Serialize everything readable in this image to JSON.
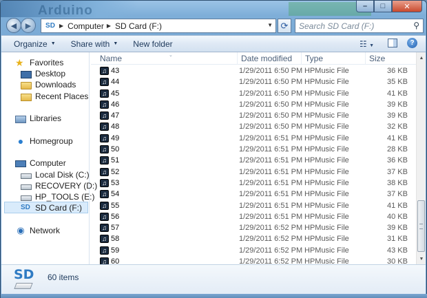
{
  "titlebar": {
    "background_text": "Arduino"
  },
  "caption_buttons": {
    "minimize": "–",
    "maximize": "□",
    "close": "✕"
  },
  "address": {
    "crumbs": [
      "Computer",
      "SD Card (F:)"
    ],
    "icon_label": "SD"
  },
  "search": {
    "placeholder": "Search SD Card (F:)"
  },
  "commands": {
    "organize": "Organize",
    "share_with": "Share with",
    "new_folder": "New folder"
  },
  "nav": {
    "favorites": "Favorites",
    "desktop": "Desktop",
    "downloads": "Downloads",
    "recent_places": "Recent Places",
    "libraries": "Libraries",
    "homegroup": "Homegroup",
    "computer": "Computer",
    "local_disk": "Local Disk (C:)",
    "recovery": "RECOVERY (D:)",
    "hp_tools": "HP_TOOLS (E:)",
    "sd_card": "SD Card (F:)",
    "network": "Network"
  },
  "columns": {
    "name": "Name",
    "date": "Date modified",
    "type": "Type",
    "size": "Size"
  },
  "files": [
    {
      "name": "43",
      "date": "1/29/2011 6:50 PM",
      "type": "HPMusic File",
      "size": "36 KB"
    },
    {
      "name": "44",
      "date": "1/29/2011 6:50 PM",
      "type": "HPMusic File",
      "size": "35 KB"
    },
    {
      "name": "45",
      "date": "1/29/2011 6:50 PM",
      "type": "HPMusic File",
      "size": "41 KB"
    },
    {
      "name": "46",
      "date": "1/29/2011 6:50 PM",
      "type": "HPMusic File",
      "size": "39 KB"
    },
    {
      "name": "47",
      "date": "1/29/2011 6:50 PM",
      "type": "HPMusic File",
      "size": "39 KB"
    },
    {
      "name": "48",
      "date": "1/29/2011 6:50 PM",
      "type": "HPMusic File",
      "size": "32 KB"
    },
    {
      "name": "49",
      "date": "1/29/2011 6:51 PM",
      "type": "HPMusic File",
      "size": "41 KB"
    },
    {
      "name": "50",
      "date": "1/29/2011 6:51 PM",
      "type": "HPMusic File",
      "size": "28 KB"
    },
    {
      "name": "51",
      "date": "1/29/2011 6:51 PM",
      "type": "HPMusic File",
      "size": "36 KB"
    },
    {
      "name": "52",
      "date": "1/29/2011 6:51 PM",
      "type": "HPMusic File",
      "size": "37 KB"
    },
    {
      "name": "53",
      "date": "1/29/2011 6:51 PM",
      "type": "HPMusic File",
      "size": "38 KB"
    },
    {
      "name": "54",
      "date": "1/29/2011 6:51 PM",
      "type": "HPMusic File",
      "size": "37 KB"
    },
    {
      "name": "55",
      "date": "1/29/2011 6:51 PM",
      "type": "HPMusic File",
      "size": "41 KB"
    },
    {
      "name": "56",
      "date": "1/29/2011 6:51 PM",
      "type": "HPMusic File",
      "size": "40 KB"
    },
    {
      "name": "57",
      "date": "1/29/2011 6:52 PM",
      "type": "HPMusic File",
      "size": "39 KB"
    },
    {
      "name": "58",
      "date": "1/29/2011 6:52 PM",
      "type": "HPMusic File",
      "size": "31 KB"
    },
    {
      "name": "59",
      "date": "1/29/2011 6:52 PM",
      "type": "HPMusic File",
      "size": "43 KB"
    },
    {
      "name": "60",
      "date": "1/29/2011 6:52 PM",
      "type": "HPMusic File",
      "size": "30 KB"
    }
  ],
  "file_icon": "music-note-icon",
  "details": {
    "logo_text": "SD",
    "item_count": "60 items"
  },
  "colors": {
    "selection": "#d9ebfb",
    "accent": "#2f7bc3"
  }
}
